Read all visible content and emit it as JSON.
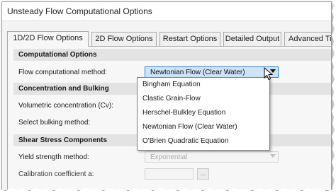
{
  "window": {
    "title": "Unsteady Flow Computational Options"
  },
  "tabs": [
    {
      "label": "1D/2D Flow Options",
      "active": true
    },
    {
      "label": "2D Flow Options",
      "active": false
    },
    {
      "label": "Restart Options",
      "active": false
    },
    {
      "label": "Detailed Output",
      "active": false
    },
    {
      "label": "Advanced Ti",
      "active": false
    }
  ],
  "sections": {
    "computational": {
      "header": "Computational Options",
      "flow_method_label": "Flow computational method:",
      "flow_method_value": "Newtonian Flow (Clear Water)"
    },
    "concentration": {
      "header": "Concentration and Bulking",
      "volumetric_label": "Volumetric concentration (Cv):",
      "bulking_label": "Select bulking method:"
    },
    "shear": {
      "header": "Shear Stress Components",
      "yield_label": "Yield strength method:",
      "yield_value": "Exponential",
      "calibration_label": "Calibration coefficient a:",
      "calibration_button": "..."
    }
  },
  "dropdown": {
    "options": [
      "Bingham Equation",
      "Clastic Grain-Flow",
      "Herschel-Bulkley Equation",
      "Newtonian Flow (Clear Water)",
      "O'Brien Quadratic Equation"
    ]
  },
  "colors": {
    "selection_fill": "#cfe3f7",
    "selection_border": "#2f7fd1",
    "section_header_bg": "#e3e3e3"
  }
}
